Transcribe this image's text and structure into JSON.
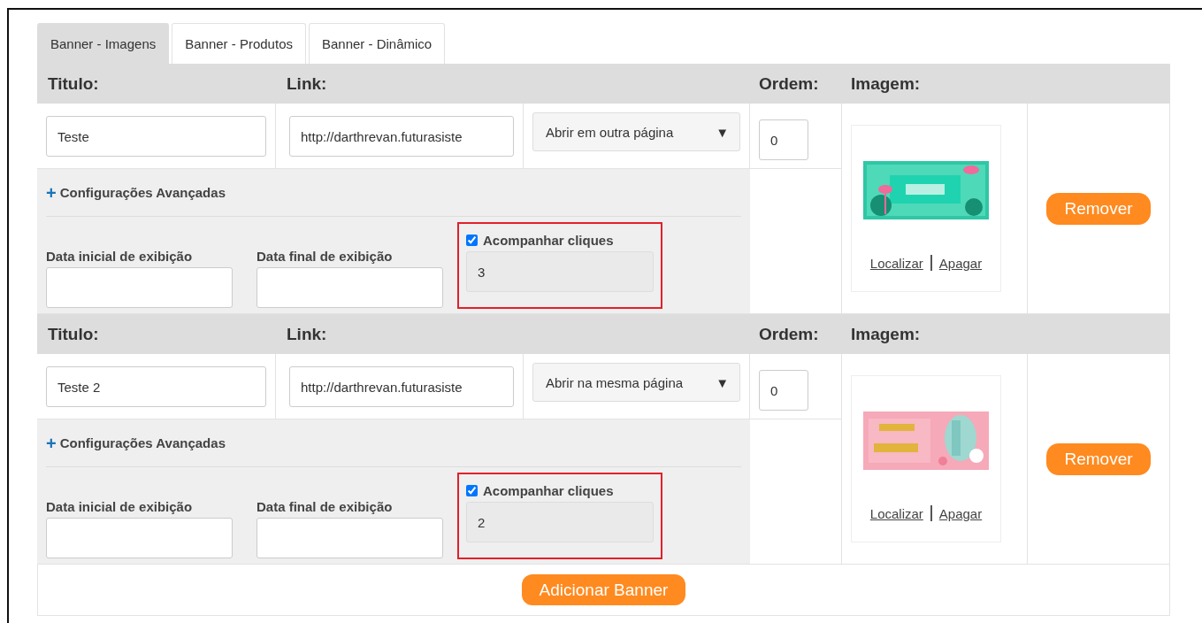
{
  "tabs": [
    {
      "label": "Banner - Imagens",
      "selected": true
    },
    {
      "label": "Banner - Produtos",
      "selected": false
    },
    {
      "label": "Banner - Dinâmico",
      "selected": false
    }
  ],
  "banners": [
    {
      "headers": {
        "title": "Titulo:",
        "link": "Link:",
        "order": "Ordem:",
        "image": "Imagem:"
      },
      "title": "Teste",
      "link": "http://darthrevan.futurasiste",
      "target": "Abrir em outra página",
      "caret": "▼",
      "order": "0",
      "advanced": {
        "toggle": "+",
        "label": "Configurações Avançadas",
        "start_label": "Data inicial de exibição",
        "end_label": "Data final de exibição",
        "track_clicks": {
          "label": "Acompanhar cliques",
          "checked": true,
          "value": "3",
          "highlighted": true
        }
      },
      "image": {
        "kind": "picture",
        "find": "Localizar",
        "delete": "Apagar"
      },
      "remove": "Remover"
    },
    {
      "headers": {
        "title": "Titulo:",
        "link": "Link:",
        "order": "Ordem:",
        "image": "Imagem:"
      },
      "title": "Teste 2",
      "link": "http://darthrevan.futurasiste",
      "target": "Abrir na mesma página",
      "caret": "▼",
      "order": "0",
      "advanced": {
        "toggle": "+",
        "label": "Configurações Avançadas",
        "start_label": "Data inicial de exibição",
        "end_label": "Data final de exibição",
        "track_clicks": {
          "label": "Acompanhar cliques",
          "checked": true,
          "value": "2",
          "highlighted": true
        }
      },
      "image": {
        "kind": "picture",
        "find": "Localizar",
        "delete": "Apagar"
      },
      "remove": "Remover"
    }
  ],
  "add_button": "Adicionar Banner"
}
